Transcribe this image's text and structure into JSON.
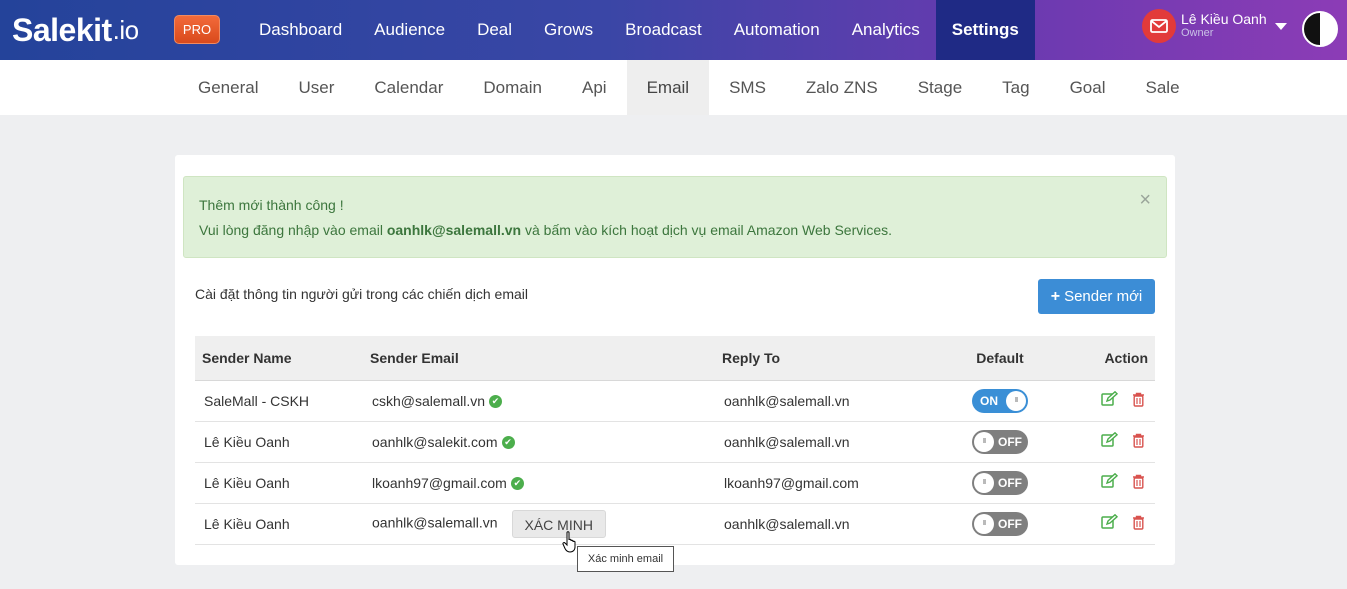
{
  "brand": {
    "name": "Salekit",
    "suffix": ".io",
    "badge": "PRO"
  },
  "nav": {
    "items": [
      "Dashboard",
      "Audience",
      "Deal",
      "Grows",
      "Broadcast",
      "Automation",
      "Analytics",
      "Settings"
    ],
    "active": "Settings"
  },
  "user": {
    "name": "Lê Kiều Oanh",
    "role": "Owner"
  },
  "subnav": {
    "items": [
      "General",
      "User",
      "Calendar",
      "Domain",
      "Api",
      "Email",
      "SMS",
      "Zalo ZNS",
      "Stage",
      "Tag",
      "Goal",
      "Sale"
    ],
    "active": "Email"
  },
  "alert": {
    "line1": "Thêm mới thành công !",
    "line2_prefix": "Vui lòng đăng nhập vào email ",
    "line2_email": "oanhlk@salemall.vn",
    "line2_suffix": " và bấm vào kích hoạt dịch vụ email Amazon Web Services.",
    "close": "×"
  },
  "section": {
    "description": "Cài đặt thông tin người gửi trong các chiến dịch email",
    "new_button": "Sender mới"
  },
  "table": {
    "headers": {
      "sender_name": "Sender Name",
      "sender_email": "Sender Email",
      "reply_to": "Reply To",
      "default": "Default",
      "action": "Action"
    },
    "rows": [
      {
        "name": "SaleMall - CSKH",
        "email": "cskh@salemall.vn",
        "verified": true,
        "reply_to": "oanhlk@salemall.vn",
        "default": "ON"
      },
      {
        "name": "Lê Kiều Oanh",
        "email": "oanhlk@salekit.com",
        "verified": true,
        "reply_to": "oanhlk@salemall.vn",
        "default": "OFF"
      },
      {
        "name": "Lê Kiều Oanh",
        "email": "lkoanh97@gmail.com",
        "verified": true,
        "reply_to": "lkoanh97@gmail.com",
        "default": "OFF"
      },
      {
        "name": "Lê Kiều Oanh",
        "email": "oanhlk@salemall.vn",
        "verified": false,
        "verify_label": "XÁC MINH",
        "reply_to": "oanhlk@salemall.vn",
        "default": "OFF"
      }
    ]
  },
  "tooltip": "Xác minh email",
  "colors": {
    "accent": "#3c8dd6",
    "success": "#4cae4c",
    "danger": "#d9534f",
    "nav_active": "#1f2a85"
  }
}
